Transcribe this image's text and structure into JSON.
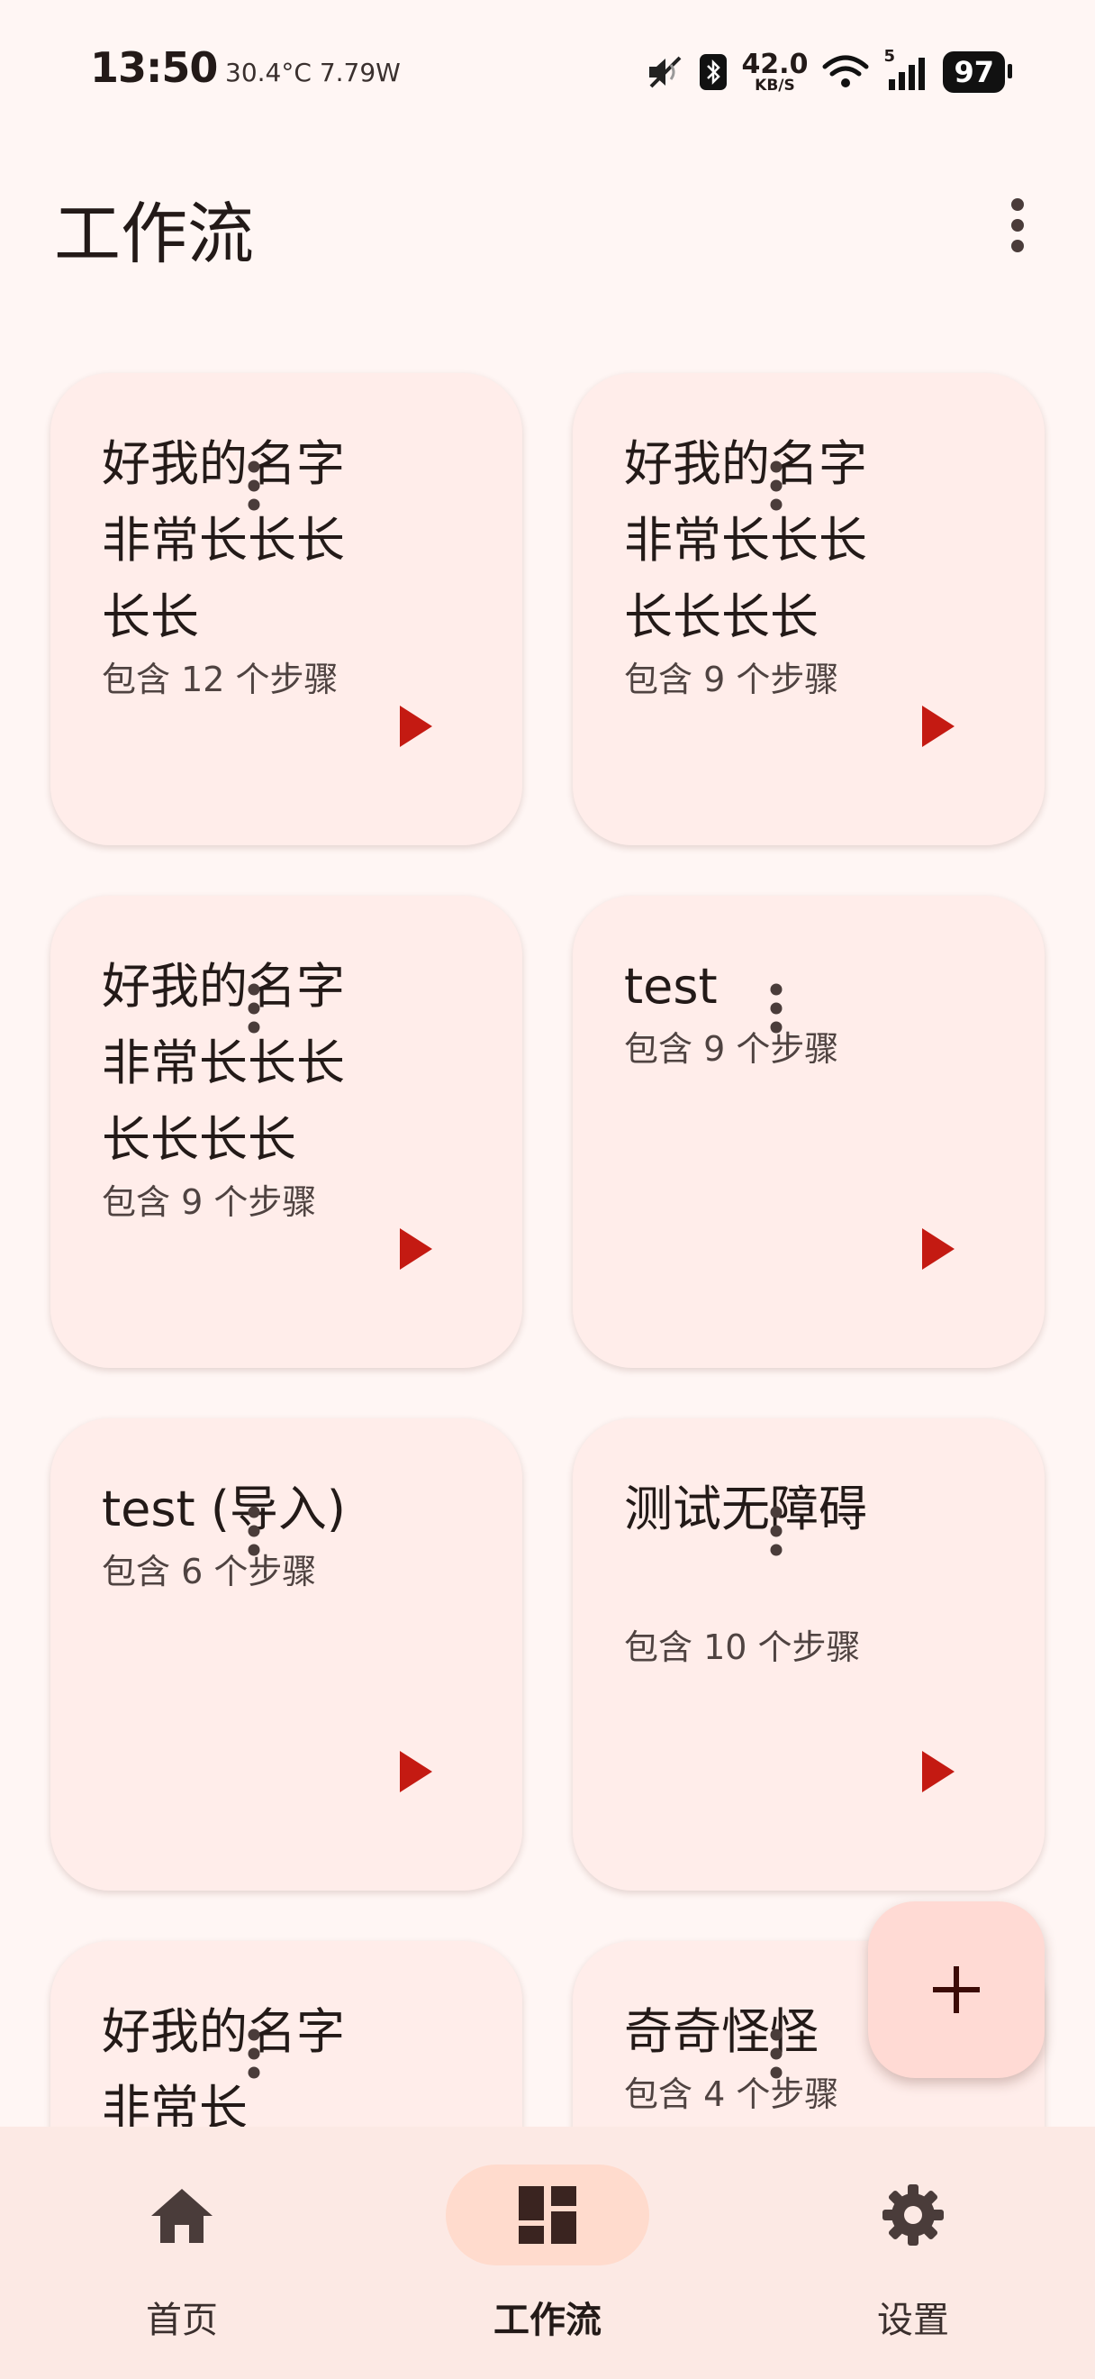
{
  "status_bar": {
    "time": "13:50",
    "temperature": "30.4°C",
    "power": "7.79W",
    "net_speed_value": "42.0",
    "net_speed_unit": "KB/S",
    "signal_label": "5",
    "battery": "97"
  },
  "header": {
    "title": "工作流"
  },
  "workflows": [
    {
      "title": "好我的名字非常长长长长长",
      "subtitle": "包含 12 个步骤"
    },
    {
      "title": "好我的名字非常长长长长长长长",
      "subtitle": "包含 9 个步骤"
    },
    {
      "title": "好我的名字非常长长长长长长长",
      "subtitle": "包含 9 个步骤"
    },
    {
      "title": "test",
      "subtitle": "包含 9 个步骤"
    },
    {
      "title": "test (导入)",
      "subtitle": "包含 6 个步骤"
    },
    {
      "title": "测试无障碍",
      "subtitle": "包含 10 个步骤"
    },
    {
      "title": "好我的名字非常长",
      "subtitle": ""
    },
    {
      "title": "奇奇怪怪",
      "subtitle": "包含 4 个步骤"
    }
  ],
  "fab": {
    "icon": "add-icon"
  },
  "bottom_nav": {
    "items": [
      {
        "label": "首页",
        "icon": "home-icon"
      },
      {
        "label": "工作流",
        "icon": "dashboard-icon",
        "active": true
      },
      {
        "label": "设置",
        "icon": "gear-icon"
      }
    ]
  },
  "colors": {
    "background": "#fff6f4",
    "card": "#ffedea",
    "play": "#c41a12",
    "fab": "#ffdad4",
    "nav_active_pill": "#ffdbcd"
  }
}
